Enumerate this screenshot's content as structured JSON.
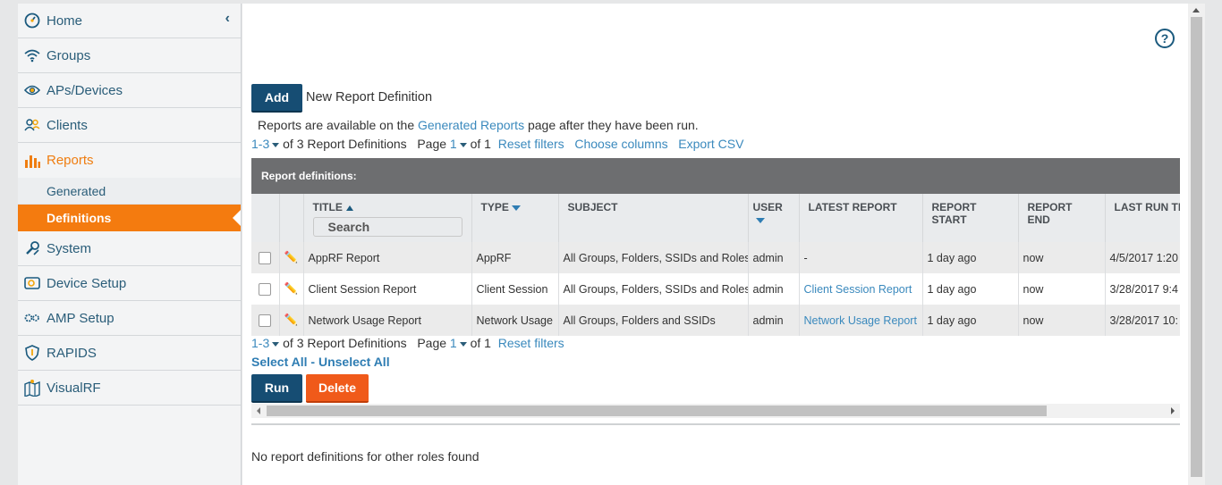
{
  "sidebar": {
    "items": [
      {
        "label": "Home",
        "icon": "gauge-icon"
      },
      {
        "label": "Groups",
        "icon": "wifi-icon"
      },
      {
        "label": "APs/Devices",
        "icon": "eye-icon"
      },
      {
        "label": "Clients",
        "icon": "users-icon"
      },
      {
        "label": "Reports",
        "icon": "bar-chart-icon"
      },
      {
        "label": "System",
        "icon": "wrench-icon"
      },
      {
        "label": "Device Setup",
        "icon": "device-setup-icon"
      },
      {
        "label": "AMP Setup",
        "icon": "gears-icon"
      },
      {
        "label": "RAPIDS",
        "icon": "shield-icon"
      },
      {
        "label": "VisualRF",
        "icon": "map-icon"
      }
    ],
    "reports_sub": [
      {
        "label": "Generated"
      },
      {
        "label": "Definitions"
      }
    ],
    "collapse_glyph": "‹",
    "active_color": "#ef7d10"
  },
  "main": {
    "help_label": "?",
    "add_button": "Add",
    "add_caption": "New Report Definition",
    "info_prefix": "Reports are available on the",
    "info_link": "Generated Reports",
    "info_suffix": "page after they have been run.",
    "pager": {
      "range": "1-3",
      "count_text": "of 3 Report Definitions",
      "page_label": "Page",
      "page_value": "1",
      "page_of": "of 1",
      "reset_filters": "Reset filters",
      "choose_columns": "Choose columns",
      "export_csv": "Export CSV"
    },
    "table": {
      "title": "Report definitions:",
      "columns": [
        "TITLE",
        "TYPE",
        "SUBJECT",
        "USER",
        "LATEST REPORT",
        "REPORT START",
        "REPORT END",
        "LAST RUN TI"
      ],
      "search_placeholder": "Search",
      "rows": [
        {
          "title": "AppRF Report",
          "type": "AppRF",
          "subject": "All Groups, Folders, SSIDs and Roles",
          "user": "admin",
          "latest": "-",
          "start": "1 day ago",
          "end": "now",
          "last_run": "4/5/2017 1:20"
        },
        {
          "title": "Client Session Report",
          "type": "Client Session",
          "subject": "All Groups, Folders, SSIDs and Roles",
          "user": "admin",
          "latest": "Client Session Report",
          "start": "1 day ago",
          "end": "now",
          "last_run": "3/28/2017 9:4"
        },
        {
          "title": "Network Usage Report",
          "type": "Network Usage",
          "subject": "All Groups, Folders and SSIDs",
          "user": "admin",
          "latest": "Network Usage Report",
          "start": "1 day ago",
          "end": "now",
          "last_run": "3/28/2017 10:"
        }
      ]
    },
    "select_all": "Select All",
    "select_sep": "-",
    "unselect_all": "Unselect All",
    "run_button": "Run",
    "delete_button": "Delete",
    "footer_text": "No report definitions for other roles found"
  },
  "colors": {
    "brand_blue": "#164d73",
    "delete_red": "#f05a1a",
    "link_blue": "#3a89bd",
    "table_header": "#6d6e70"
  }
}
